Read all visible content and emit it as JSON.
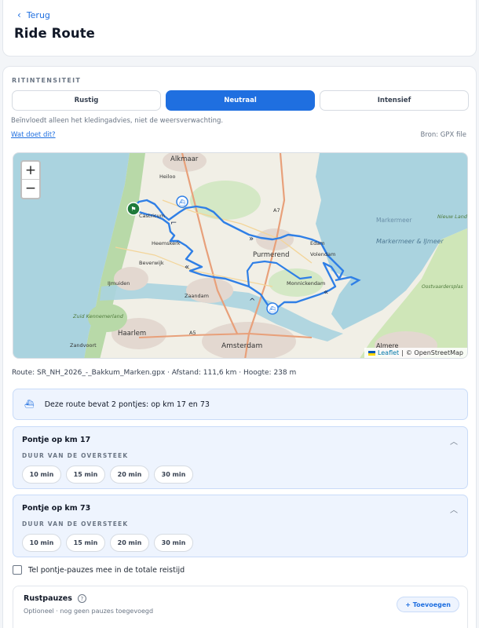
{
  "header": {
    "back_label": "Terug",
    "title": "Ride Route"
  },
  "intensity": {
    "section_label": "RITINTENSITEIT",
    "options": [
      "Rustig",
      "Neutraal",
      "Intensief"
    ],
    "selected": "Neutraal",
    "hint": "Beïnvloedt alleen het kledingadvies, niet de weersverwachting.",
    "why_link": "Wat doet dit?",
    "source": "Bron: GPX file"
  },
  "map": {
    "zoom_in": "+",
    "zoom_out": "−",
    "attribution_leaflet": "Leaflet",
    "attribution_sep": "|",
    "attribution_osm": "© OpenStreetMap",
    "places": [
      "Alkmaar",
      "Heiloo",
      "Castricum",
      "Heemskerk",
      "Beverwijk",
      "IJmuiden",
      "Purmerend",
      "Edam",
      "Volendam",
      "Monnickendam",
      "Zaandam",
      "Haarlem",
      "Zandvoort",
      "Amsterdam",
      "Almere",
      "Markermeer",
      "Markermeer & IJmeer",
      "Nieuw Land",
      "Oostvaardersplas",
      "Zuid Kennemerland",
      "A7",
      "A5"
    ],
    "route_color": "#2f7fe6"
  },
  "route_meta": "Route: SR_NH_2026_-_Bakkum_Marken.gpx · Afstand: 111,6 km · Hoogte: 238 m",
  "ferry_notice": "Deze route bevat 2 pontjes: op km 17 en 73",
  "ferries": [
    {
      "title": "Pontje op km 17",
      "duration_label": "DUUR VAN DE OVERSTEEK",
      "options": [
        "10 min",
        "15 min",
        "20 min",
        "30 min"
      ]
    },
    {
      "title": "Pontje op km 73",
      "duration_label": "DUUR VAN DE OVERSTEEK",
      "options": [
        "10 min",
        "15 min",
        "20 min",
        "30 min"
      ]
    }
  ],
  "include_pauses_label": "Tel pontje-pauzes mee in de totale reistijd",
  "rest": {
    "title": "Rustpauzes",
    "subtitle": "Optioneel · nog geen pauzes toegevoegd",
    "add_button": "+ Toevoegen"
  }
}
